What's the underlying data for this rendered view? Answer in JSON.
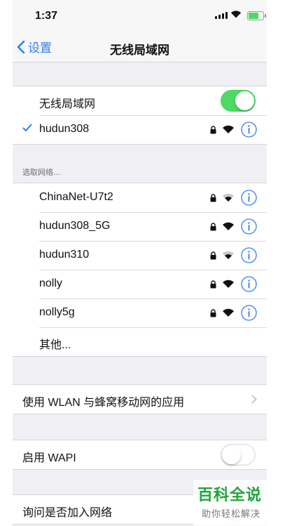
{
  "status_bar": {
    "time": "1:37"
  },
  "nav": {
    "back_label": "设置",
    "title": "无线局域网"
  },
  "wifi_toggle": {
    "label": "无线局域网",
    "enabled": true
  },
  "connected_network": {
    "name": "hudun308",
    "secured": true,
    "icons": [
      "checkmark-icon",
      "lock-icon",
      "wifi-icon",
      "info-icon"
    ]
  },
  "choose_network": {
    "header": "选取网络…",
    "networks": [
      {
        "name": "ChinaNet-U7t2",
        "secured": true
      },
      {
        "name": "hudun308_5G",
        "secured": true
      },
      {
        "name": "hudun310",
        "secured": true
      },
      {
        "name": "nolly",
        "secured": true
      },
      {
        "name": "nolly5g",
        "secured": true
      }
    ],
    "other_label": "其他..."
  },
  "wlan_apps": {
    "label": "使用 WLAN 与蜂窝移动网的应用"
  },
  "wapi": {
    "label": "启用 WAPI",
    "enabled": false
  },
  "ask_join": {
    "label": "询问是否加入网络"
  },
  "watermark": {
    "title": "百科全说",
    "subtitle": "助你轻松解决"
  },
  "colors": {
    "accent": "#2f7df6",
    "toggle_on": "#4cd964",
    "background": "#efeff4"
  }
}
